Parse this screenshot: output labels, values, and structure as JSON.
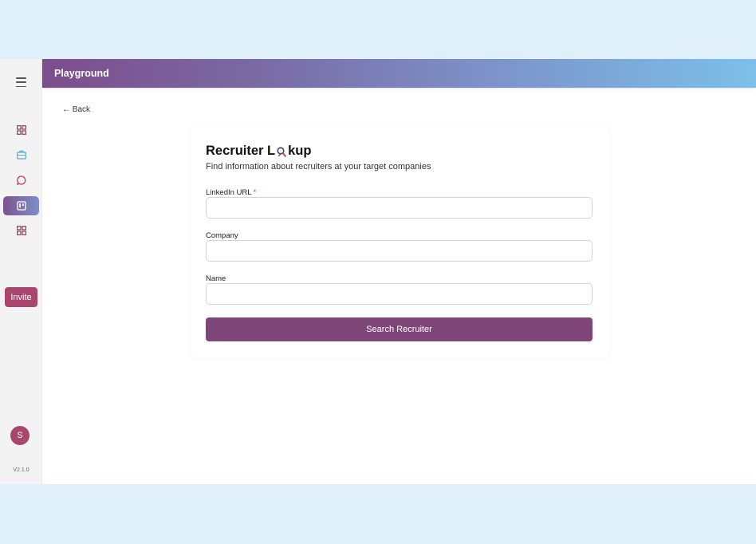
{
  "app": {
    "header_title": "Playground",
    "version": "V2.1.0"
  },
  "sidebar": {
    "menu_icon": "hamburger-menu-icon",
    "items": [
      {
        "icon": "dashboard-grid-icon",
        "color": "#8a3f5a",
        "active": false
      },
      {
        "icon": "briefcase-icon",
        "color": "#5aa9d0",
        "active": false
      },
      {
        "icon": "chat-bubble-icon",
        "color": "#c0304a",
        "active": false
      },
      {
        "icon": "board-icon",
        "color": "#ffffff",
        "active": true
      },
      {
        "icon": "apps-grid-icon",
        "color": "#8a3f5a",
        "active": false
      }
    ],
    "invite_label": "Invite",
    "avatar_initial": "S"
  },
  "nav": {
    "back_label": "← Back"
  },
  "form": {
    "title_prefix": "Recruiter L",
    "title_suffix": "kup",
    "title_icon": "magnifier-icon",
    "subtitle": "Find information about recruiters at your target companies",
    "fields": [
      {
        "label": "LinkedIn URL",
        "required": true,
        "required_mark": "*",
        "value": "",
        "placeholder": ""
      },
      {
        "label": "Company",
        "required": false,
        "value": "",
        "placeholder": ""
      },
      {
        "label": "Name",
        "required": false,
        "value": "",
        "placeholder": ""
      }
    ],
    "submit_label": "Search Recruiter"
  },
  "colors": {
    "accent": "#a8466e",
    "button": "#7f4679",
    "header_gradient_start": "#7c4d8c",
    "header_gradient_end": "#7cc0ea",
    "required": "#e0384c"
  }
}
